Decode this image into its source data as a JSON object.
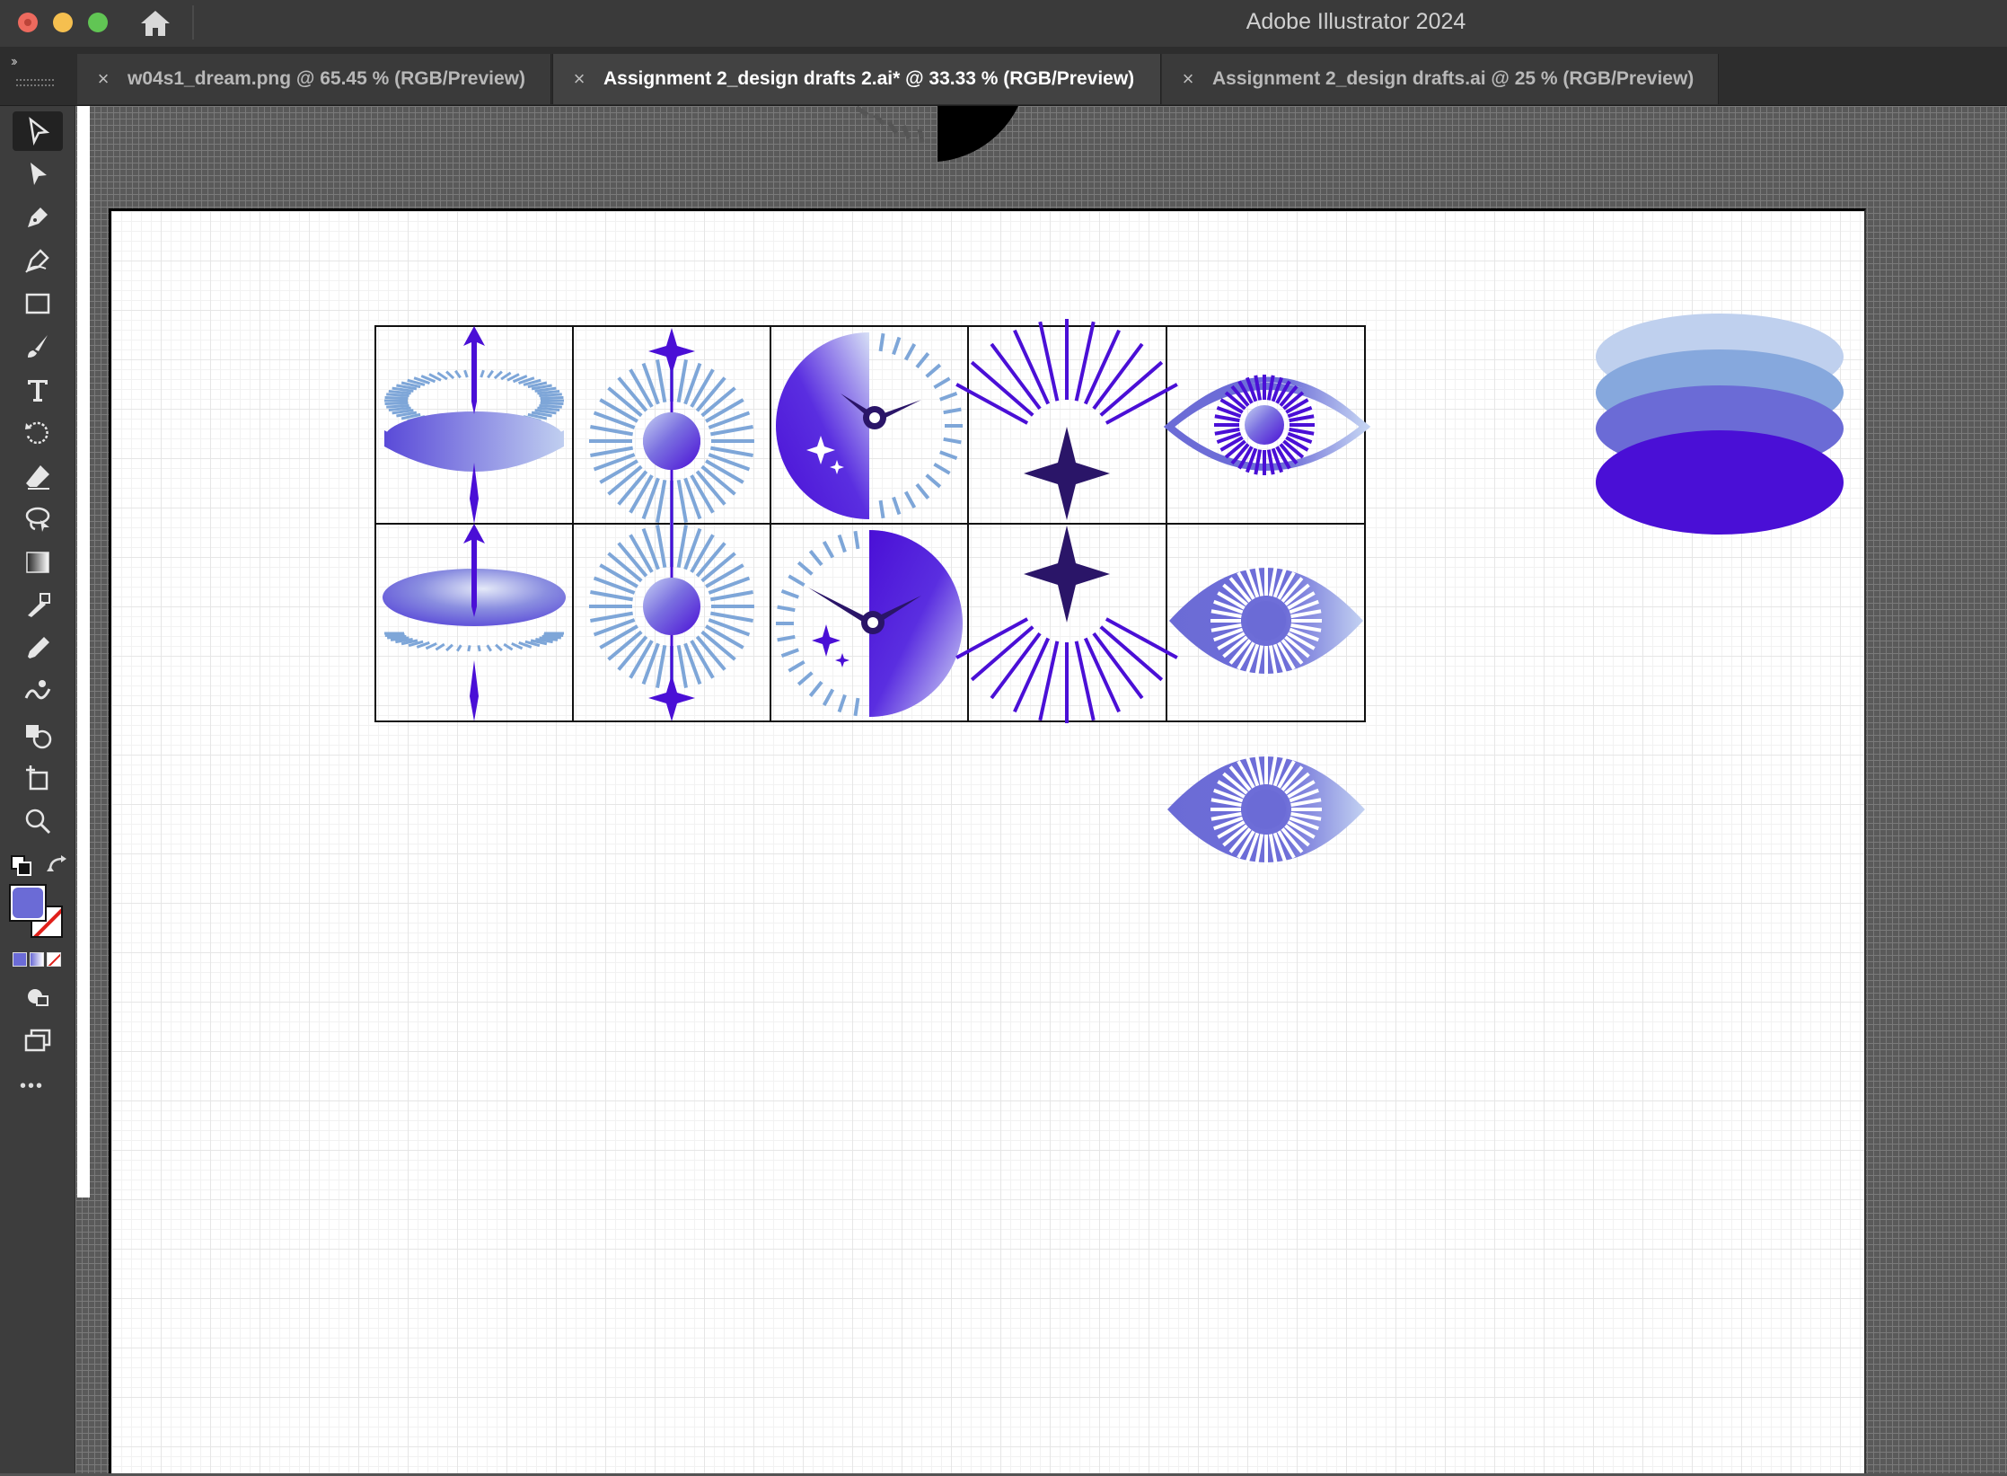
{
  "window": {
    "title": "Adobe Illustrator 2024",
    "traffic_lights": [
      "close-button",
      "minimize-button",
      "maximize-button"
    ],
    "home_icon": "home-icon"
  },
  "tabs": [
    {
      "label": "w04s1_dream.png @ 65.45 % (RGB/Preview)",
      "close": "×",
      "active": false
    },
    {
      "label": "Assignment 2_design drafts 2.ai* @ 33.33 % (RGB/Preview)",
      "close": "×",
      "active": true
    },
    {
      "label": "Assignment 2_design drafts.ai @ 25 % (RGB/Preview)",
      "close": "×",
      "active": false
    }
  ],
  "panel_expand": "››",
  "toolbar": {
    "tools": [
      "selection-tool-icon",
      "direct-selection-tool-icon",
      "pen-tool-icon",
      "curvature-tool-icon",
      "rectangle-tool-icon",
      "paintbrush-tool-icon",
      "type-tool-icon",
      "rotate-tool-icon",
      "eraser-tool-icon",
      "lasso-tool-icon",
      "gradient-tool-icon",
      "blend-tool-icon",
      "eyedropper-tool-icon",
      "puppet-warp-tool-icon",
      "shape-builder-tool-icon",
      "artboard-tool-icon",
      "zoom-tool-icon"
    ],
    "more": "•••",
    "fill_color": "#6b6bd6",
    "stroke": "none"
  },
  "colors": {
    "deep_violet": "#4a0fd6",
    "indigo": "#2a1568",
    "periwinkle": "#6b6bd6",
    "light_blue": "#7ea6d8",
    "pale_blue": "#bfd0ee",
    "mid_blue": "#86a8dd"
  }
}
